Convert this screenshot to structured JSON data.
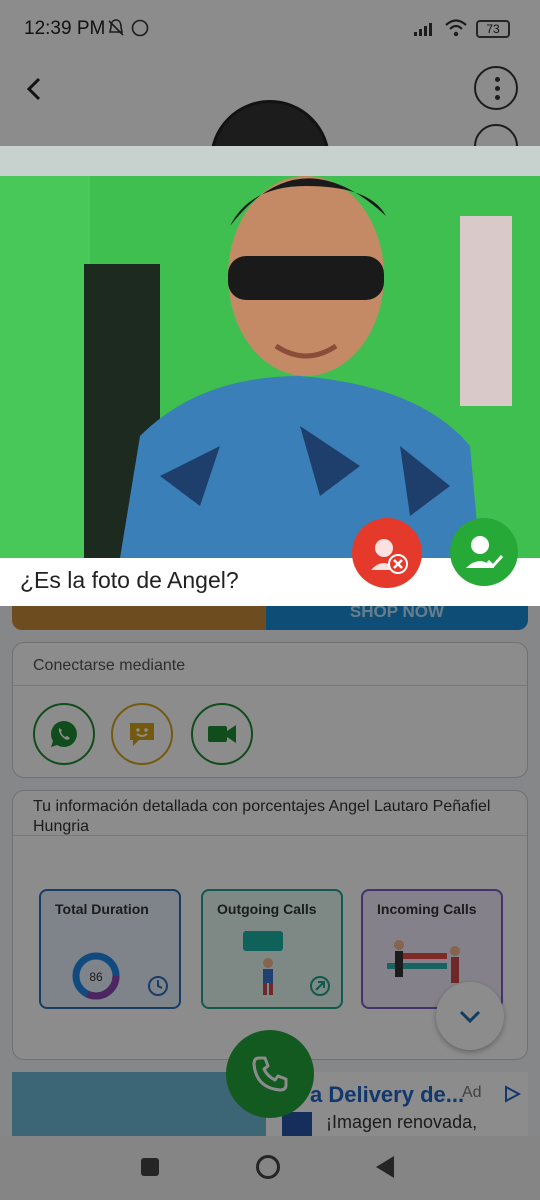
{
  "status_bar": {
    "time": "12:39 PM",
    "battery": "73"
  },
  "dialog": {
    "question": "¿Es la foto de Angel?"
  },
  "banner": {
    "cta": "SHOP NOW"
  },
  "connect": {
    "label": "Conectarse mediante"
  },
  "info": {
    "label": "Tu información detallada con porcentajes Angel Lautaro Peñafiel Hungria",
    "stats": [
      {
        "title": "Total Duration",
        "value": "86"
      },
      {
        "title": "Outgoing Calls"
      },
      {
        "title": "Incoming Calls"
      }
    ]
  },
  "ad": {
    "title": "a Delivery de...",
    "ad_label": "Ad",
    "description": "¡Imagen renovada,"
  },
  "colors": {
    "accept": "#26a936",
    "reject": "#e53a2b",
    "call": "#21a53a",
    "photo_bg": "#3fbf4f"
  }
}
